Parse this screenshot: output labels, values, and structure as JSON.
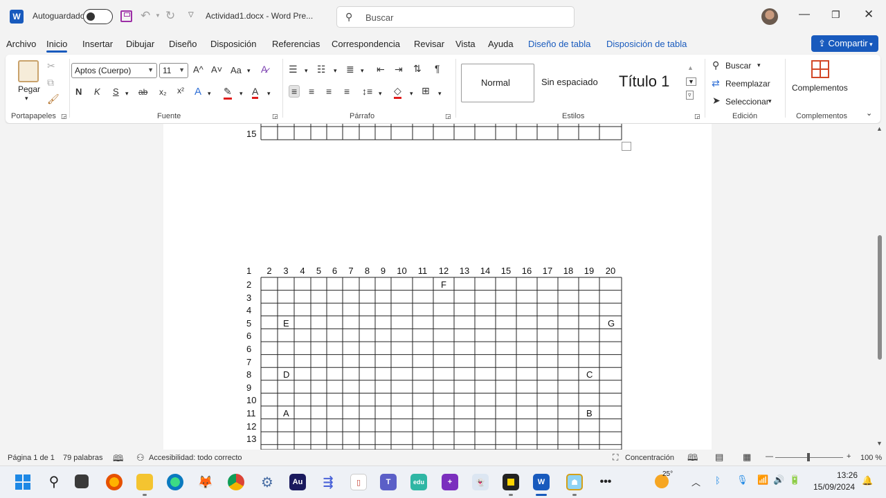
{
  "titlebar": {
    "app_logo": "W",
    "autosave_label": "Autoguardado",
    "doc_title": "Actividad1.docx  -  Word Pre...",
    "search_placeholder": "Buscar",
    "icons": [
      "word-icon",
      "save-icon",
      "undo-icon",
      "redo-icon",
      "customize-qat-icon",
      "search-icon",
      "minimize-icon",
      "restore-icon",
      "close-icon"
    ]
  },
  "tabs": {
    "items": [
      "Archivo",
      "Inicio",
      "Insertar",
      "Dibujar",
      "Diseño",
      "Disposición",
      "Referencias",
      "Correspondencia",
      "Revisar",
      "Vista",
      "Ayuda",
      "Diseño de tabla",
      "Disposición de tabla"
    ],
    "active": "Inicio",
    "share_label": "Compartir"
  },
  "ribbon": {
    "clipboard": {
      "paste_label": "Pegar",
      "group_label": "Portapapeles"
    },
    "font": {
      "font_name": "Aptos (Cuerpo)",
      "font_size": "11",
      "bold": "N",
      "italic": "K",
      "underline": "S",
      "strike": "ab",
      "subscript": "x₂",
      "superscript": "x²",
      "grow": "A^",
      "shrink": "A˅",
      "case": "Aa",
      "group_label": "Fuente"
    },
    "paragraph": {
      "pilcrow": "¶",
      "group_label": "Párrafo"
    },
    "styles": {
      "items": [
        "Normal",
        "Sin espaciado",
        "Título 1"
      ],
      "group_label": "Estilos"
    },
    "editing": {
      "find_label": "Buscar",
      "replace_label": "Reemplazar",
      "select_label": "Seleccionar",
      "group_label": "Edición"
    },
    "addins": {
      "label": "Complementos",
      "group_label": "Complementos"
    }
  },
  "document": {
    "top_table_row_label": "15",
    "table": {
      "header_numbers": [
        "1",
        "2",
        "3",
        "4",
        "5",
        "6",
        "7",
        "8",
        "9",
        "10",
        "11",
        "12",
        "13",
        "14",
        "15",
        "16",
        "17",
        "18",
        "19",
        "20"
      ],
      "row_labels": [
        "2",
        "3",
        "4",
        "5",
        "6",
        "6",
        "7",
        "8",
        "9",
        "10",
        "11",
        "12",
        "13"
      ],
      "letters": [
        {
          "label": "F",
          "row": 0,
          "col": 12
        },
        {
          "label": "E",
          "row": 3,
          "col": 3
        },
        {
          "label": "G",
          "row": 3,
          "col": 20
        },
        {
          "label": "D",
          "row": 7,
          "col": 3
        },
        {
          "label": "C",
          "row": 7,
          "col": 19
        },
        {
          "label": "A",
          "row": 10,
          "col": 3
        },
        {
          "label": "B",
          "row": 10,
          "col": 19
        }
      ]
    }
  },
  "statusbar": {
    "page": "Página 1 de 1",
    "words": "79 palabras",
    "accessibility": "Accesibilidad: todo correcto",
    "focus": "Concentración",
    "zoom": "100 %"
  },
  "taskbar": {
    "weather": "25°",
    "time": "13:26",
    "date": "15/09/2024",
    "apps": [
      "Au",
      "edu"
    ]
  }
}
